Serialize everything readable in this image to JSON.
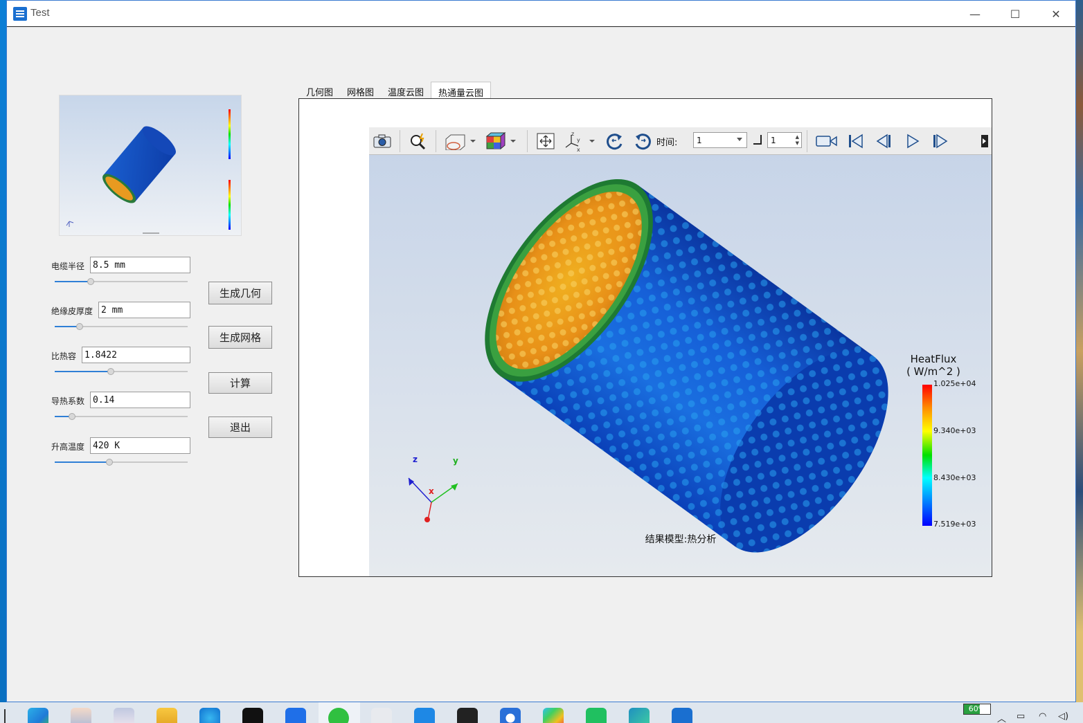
{
  "window": {
    "title": "Test",
    "minimize": "—",
    "maximize": "☐",
    "close": "✕"
  },
  "params": [
    {
      "label": "电缆半径",
      "value": "8.5 mm",
      "slider": 0.27
    },
    {
      "label": "绝缘皮厚度",
      "value": "2 mm",
      "slider": 0.19
    },
    {
      "label": "比热容",
      "value": "1.8422",
      "slider": 0.42
    },
    {
      "label": "导热系数",
      "value": "0.14",
      "slider": 0.13
    },
    {
      "label": "升高温度",
      "value": "420 K",
      "slider": 0.41
    }
  ],
  "buttons": {
    "generate_geometry": "生成几何",
    "generate_mesh": "生成网格",
    "compute": "计算",
    "exit": "退出"
  },
  "tabs": [
    {
      "label": "几何图",
      "active": false
    },
    {
      "label": "网格图",
      "active": false
    },
    {
      "label": "温度云图",
      "active": false
    },
    {
      "label": "热通量云图",
      "active": true
    }
  ],
  "toolbar": {
    "time_label": "时间:",
    "time_value": "1",
    "step_value": "1",
    "icons": [
      "camera-icon",
      "zoom-icon",
      "clip-plane-icon",
      "color-cube-icon",
      "fit-view-icon",
      "axes-icon",
      "rotate-left-icon",
      "rotate-right-icon",
      "record-icon",
      "first-frame-icon",
      "prev-frame-icon",
      "play-icon",
      "next-frame-icon",
      "more-icon"
    ]
  },
  "legend": {
    "title": "HeatFlux",
    "unit": "( W/m^2 )",
    "ticks": [
      "1.025e+04",
      "9.340e+03",
      "8.430e+03",
      "7.519e+03"
    ],
    "colors": [
      "#ff0000",
      "#ffff00",
      "#00e000",
      "#00ffff",
      "#0000ff"
    ]
  },
  "axes": {
    "x": "x",
    "y": "y",
    "z": "z"
  },
  "caption": "结果模型:热分析",
  "taskbar": {
    "battery": "60%",
    "apps": [
      "edge-icon",
      "anime-avatar-icon",
      "anime-avatar-icon-2",
      "folder-icon",
      "browser-icon",
      "tiktok-icon",
      "lark-icon",
      "wechat-icon",
      "app-icon",
      "feishu-icon",
      "app-icon-2",
      "blue-app-icon",
      "play-store-icon",
      "green-app-icon",
      "edge-beta-icon",
      "test-app-icon"
    ]
  }
}
